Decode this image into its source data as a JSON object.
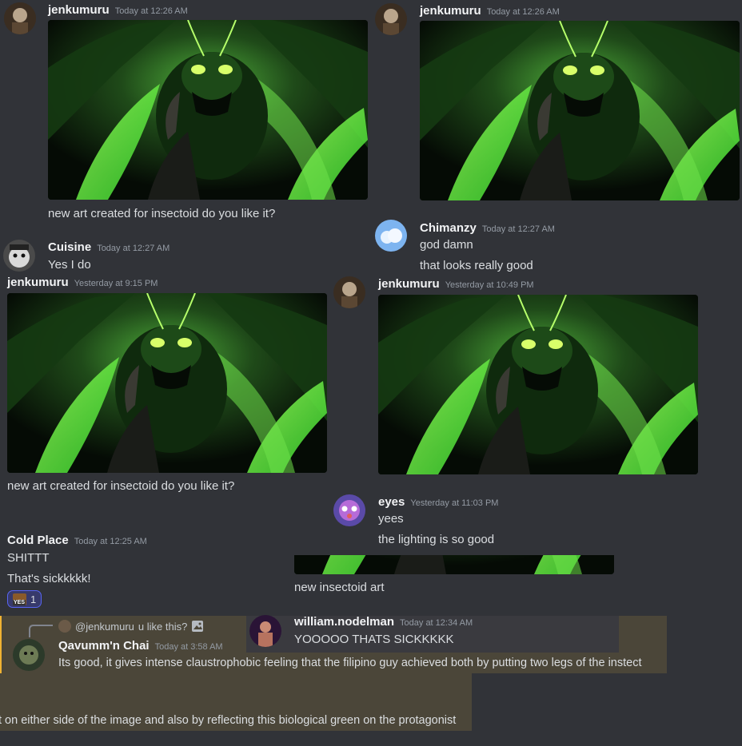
{
  "messages": {
    "m1": {
      "user": "jenkumuru",
      "time": "Today at 12:26 AM",
      "text": "new art created for insectoid do you like it?"
    },
    "m2": {
      "user": "jenkumuru",
      "time": "Today at 12:26 AM"
    },
    "m3": {
      "user": "Chimanzy",
      "time": "Today at 12:27 AM",
      "line1": "god damn",
      "line2": "that looks really good"
    },
    "m4": {
      "user": "Cuisine",
      "time": "Today at 12:27 AM",
      "text": "Yes I do"
    },
    "m5": {
      "user": "jenkumuru",
      "time": "Yesterday at 9:15 PM",
      "text": "new art created for insectoid do you like it?"
    },
    "m6": {
      "user": "jenkumuru",
      "time": "Yesterday at 10:49 PM"
    },
    "m7": {
      "user": "eyes",
      "time": "Yesterday at 11:03 PM",
      "line1": "yees",
      "line2": "the lighting is so good"
    },
    "m8": {
      "user": "Cold Place",
      "time": "Today at 12:25 AM",
      "line1": "SHITTT",
      "line2": "That's sickkkkk!",
      "reaction_badge": "YES",
      "reaction_count": "1"
    },
    "m9": {
      "text": "new insectoid art"
    },
    "m10": {
      "user": "william.nodelman",
      "time": "Today at 12:34 AM",
      "text": "YOOOOO THATS SICKKKKK"
    },
    "m11": {
      "reply_user": "@jenkumuru",
      "reply_text": "u like this?",
      "user": "Qavumm'n Chai",
      "time": "Today at 3:58 AM",
      "line1": "Its good, it gives intense claustrophobic feeling that the filipino guy achieved both by putting two legs of the instect",
      "line2": "t on either side of the image and also by reflecting this biological green on the protagonist"
    }
  },
  "icons": {
    "image": "image-icon",
    "reply": "reply-spine-icon"
  },
  "colors": {
    "background": "#313338",
    "highlight": "#4b4639",
    "mention_bar": "#f0b232",
    "reaction_border": "#5865f2"
  }
}
